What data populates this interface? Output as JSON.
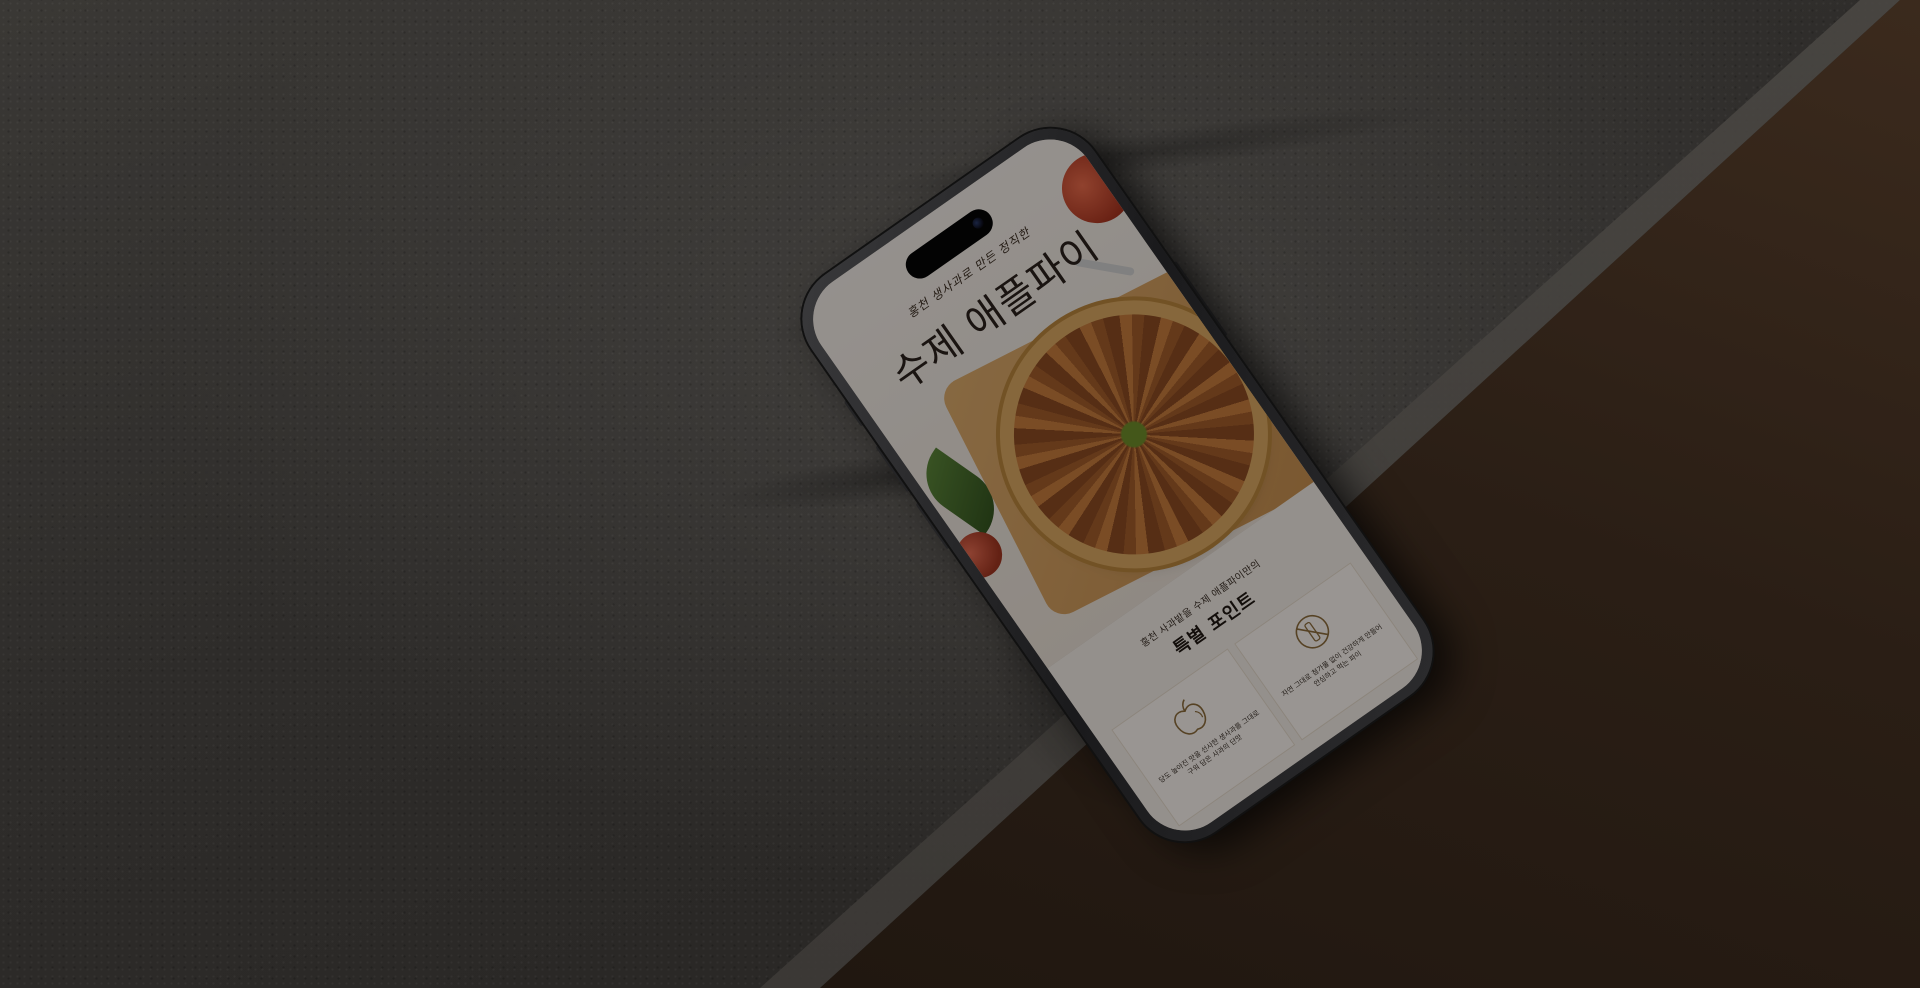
{
  "scene": {
    "description_colors": {
      "concrete": "#3a3835",
      "brown_surface": "#2a1e15",
      "screen_bg": "#efe9e3"
    }
  },
  "phone_screen": {
    "hero": {
      "kicker": "홍천 생사과로 만든 정직한",
      "title": "수제 애플파이"
    },
    "features": {
      "subtitle": "홍천 사과밭을 수제 애플파이만의",
      "title_a": "특별",
      "title_b": "포인트",
      "cards": [
        {
          "icon": "apple-icon",
          "text": "당도 높아진 맛을 선사한 생사과를 그대로 구워 담은 사과의 단맛"
        },
        {
          "icon": "no-additive-icon",
          "text": "자연 그대로 첨가물 없이 건강하게 만들어 안심하고 먹는 파이"
        }
      ]
    }
  }
}
